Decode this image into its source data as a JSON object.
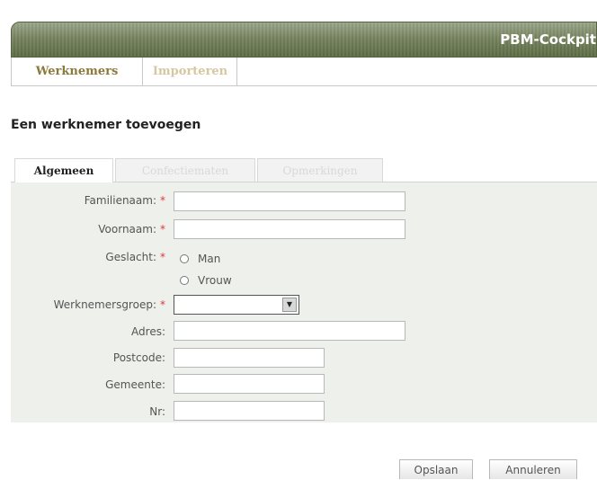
{
  "app": {
    "title": "PBM-Cockpit"
  },
  "main_tabs": [
    {
      "label": "Werknemers",
      "active": true
    },
    {
      "label": "Importeren",
      "active": false
    }
  ],
  "page_title": "Een werknemer toevoegen",
  "sub_tabs": [
    {
      "label": "Algemeen",
      "active": true
    },
    {
      "label": "Confectiematen",
      "active": false
    },
    {
      "label": "Opmerkingen",
      "active": false
    }
  ],
  "form": {
    "required_marker": "*",
    "familienaam": {
      "label": "Familienaam:",
      "value": ""
    },
    "voornaam": {
      "label": "Voornaam:",
      "value": ""
    },
    "geslacht": {
      "label": "Geslacht:",
      "options": [
        "Man",
        "Vrouw"
      ],
      "selected": null
    },
    "werknemersgroep": {
      "label": "Werknemersgroep:",
      "value": ""
    },
    "adres": {
      "label": "Adres:",
      "value": ""
    },
    "postcode": {
      "label": "Postcode:",
      "value": ""
    },
    "gemeente": {
      "label": "Gemeente:",
      "value": ""
    },
    "nr": {
      "label": "Nr:",
      "value": ""
    }
  },
  "buttons": {
    "save": "Opslaan",
    "cancel": "Annuleren"
  },
  "colors": {
    "header_green": "#6f7c57",
    "active_tab_text": "#8b7a3a",
    "required_red": "#d93a3a",
    "form_background": "#eef0ec"
  }
}
